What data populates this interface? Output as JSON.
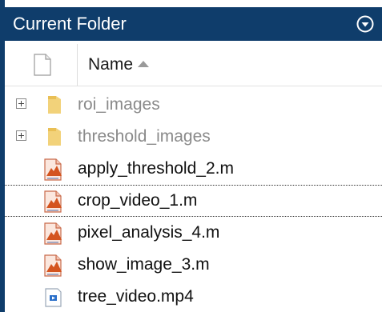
{
  "panel": {
    "title": "Current Folder",
    "header_bg": "#0f3d6b"
  },
  "columns": {
    "name": "Name",
    "sort": "ascending"
  },
  "items": [
    {
      "name": "roi_images",
      "type": "folder",
      "icon": "folder-icon"
    },
    {
      "name": "threshold_images",
      "type": "folder",
      "icon": "folder-icon"
    },
    {
      "name": "apply_threshold_2.m",
      "type": "file",
      "icon": "matlab-script-icon"
    },
    {
      "name": "crop_video_1.m",
      "type": "file",
      "icon": "matlab-script-icon",
      "selected": true
    },
    {
      "name": "pixel_analysis_4.m",
      "type": "file",
      "icon": "matlab-script-icon"
    },
    {
      "name": "show_image_3.m",
      "type": "file",
      "icon": "matlab-script-icon"
    },
    {
      "name": "tree_video.mp4",
      "type": "file",
      "icon": "video-file-icon"
    }
  ]
}
